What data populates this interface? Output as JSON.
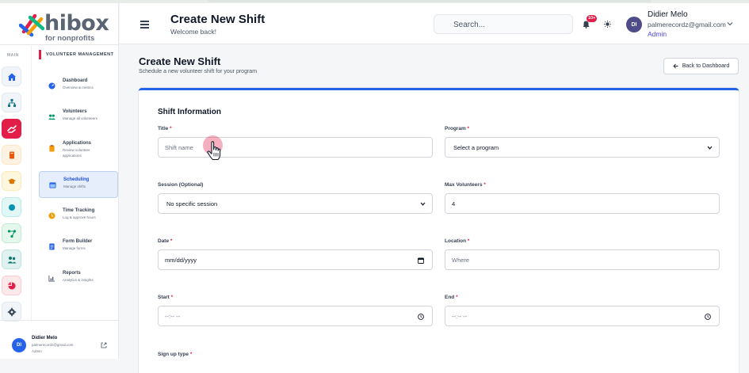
{
  "brand": {
    "name": "hibox",
    "tagline": "for nonprofits"
  },
  "rail": {
    "label": "MAIN"
  },
  "sidebar": {
    "section": "VOLUNTEER MANAGEMENT",
    "items": [
      {
        "title": "Dashboard",
        "subtitle": "Overview & metrics",
        "icon": "dashboard-icon"
      },
      {
        "title": "Volunteers",
        "subtitle": "Manage all volunteers",
        "icon": "users-icon"
      },
      {
        "title": "Applications",
        "subtitle": "Review volunteer applications",
        "icon": "clipboard-icon"
      },
      {
        "title": "Scheduling",
        "subtitle": "Manage shifts",
        "icon": "calendar-icon",
        "active": true
      },
      {
        "title": "Time Tracking",
        "subtitle": "Log & approve hours",
        "icon": "clock-icon"
      },
      {
        "title": "Form Builder",
        "subtitle": "Manage forms",
        "icon": "form-icon"
      },
      {
        "title": "Reports",
        "subtitle": "Analytics & insights",
        "icon": "chart-icon"
      }
    ],
    "footer": {
      "initials": "DI",
      "name": "Didier Melo",
      "email": "palmerecordz@gmail.com",
      "role": "Admin"
    }
  },
  "header": {
    "title": "Create New Shift",
    "subtitle": "Welcome back!",
    "search_placeholder": "Search...",
    "notification_count": "10+",
    "user": {
      "initials": "DI",
      "name": "Didier Melo",
      "email": "palmerecordz@gmail.com",
      "role": "Admin"
    }
  },
  "page": {
    "title": "Create New Shift",
    "subtitle": "Schedule a new volunteer shift for your program",
    "back_label": "Back to Dashboard"
  },
  "form": {
    "section_title": "Shift Information",
    "title_label": "Title",
    "title_placeholder": "Shift name",
    "program_label": "Program",
    "program_value": "Select a program",
    "session_label": "Session (Optional)",
    "session_value": "No specific session",
    "max_label": "Max Volunteers",
    "max_value": "4",
    "date_label": "Date",
    "date_value": "mm/dd/yyyy",
    "location_label": "Location",
    "location_placeholder": "Where",
    "start_label": "Start",
    "start_value": "--:-- --",
    "end_label": "End",
    "end_value": "--:-- --",
    "signup_label": "Sign up type",
    "required_mark": "*"
  },
  "colors": {
    "accent": "#e11d48",
    "primary": "#2563eb",
    "avatar": "#4f4c8c"
  }
}
